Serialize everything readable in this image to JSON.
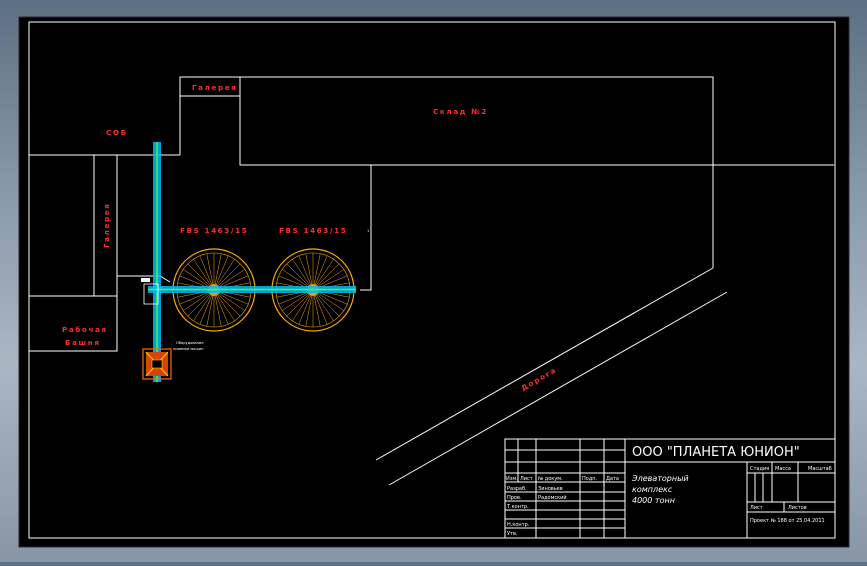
{
  "drawing": {
    "labels": {
      "cob": "СОБ",
      "galereya_top": "Галерея",
      "sklad": "Склад №2",
      "galereya_side": "Галерея",
      "silo1": "FBS 1463/15",
      "silo2": "FBS 1463/15",
      "rabochaya_line1": "Рабочая",
      "rabochaya_line2": "Башня",
      "doroga": "Дорога",
      "equipment_note_line1": "Оборудование",
      "equipment_note_line2": "приемки машин"
    },
    "title_block": {
      "company": "ООО \"ПЛАНЕТА ЮНИОН\"",
      "project_line1": "Элеваторный",
      "project_line2": "комплекс",
      "project_line3": "4000 тонн",
      "hdr_izm": "Изм.",
      "hdr_list": "Лист",
      "hdr_doc": "№ докум.",
      "hdr_podp": "Подп.",
      "hdr_data": "Дата",
      "razrab": "Разраб.",
      "razrab_name": "Зиновьев",
      "prov": "Пров.",
      "prov_name": "Радомский",
      "tkontr": "Т.контр.",
      "nkontr": "Н.контр.",
      "utv": "Утв.",
      "stage": "Стадия",
      "mass": "Масса",
      "scale": "Масштаб",
      "sheet": "Лист",
      "sheets": "Листов",
      "order_note": "Проект № 188 от 25.04.2011"
    },
    "colors": {
      "background": "#000000",
      "lines": "#ffffff",
      "labels": "#ff2a2a",
      "silo": "#ffa800",
      "conveyor": "#00c8ff",
      "conveyor_core": "#3cff3c",
      "equipment_frame": "#ff6a00",
      "equipment_body": "#d84400"
    }
  }
}
